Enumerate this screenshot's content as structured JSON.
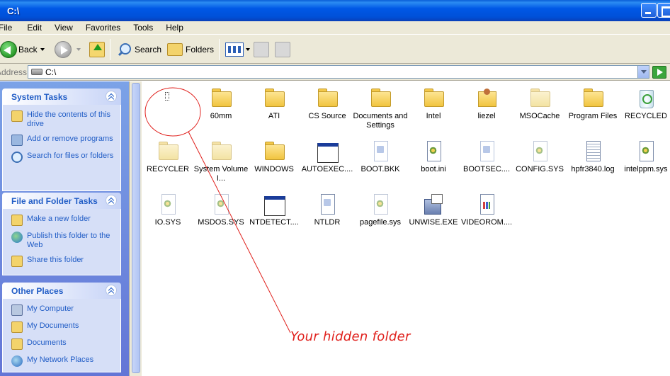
{
  "window": {
    "title": "C:\\"
  },
  "menu": [
    "File",
    "Edit",
    "View",
    "Favorites",
    "Tools",
    "Help"
  ],
  "toolbar": {
    "back_label": "Back",
    "search_label": "Search",
    "folders_label": "Folders"
  },
  "address": {
    "label": "Address",
    "value": "C:\\"
  },
  "panels": {
    "system_tasks": {
      "title": "System Tasks",
      "items": [
        "Hide the contents of this drive",
        "Add or remove programs",
        "Search for files or folders"
      ]
    },
    "file_folder_tasks": {
      "title": "File and Folder Tasks",
      "items": [
        "Make a new folder",
        "Publish this folder to the Web",
        "Share this folder"
      ]
    },
    "other_places": {
      "title": "Other Places",
      "items": [
        "My Computer",
        "My Documents",
        "Documents",
        "My Network Places"
      ]
    }
  },
  "files": [
    {
      "name": "",
      "icon": "hidden-folder-icon"
    },
    {
      "name": "60mm",
      "icon": "folder-icon"
    },
    {
      "name": "ATI",
      "icon": "folder-icon"
    },
    {
      "name": "CS Source",
      "icon": "folder-icon"
    },
    {
      "name": "Documents and Settings",
      "icon": "folder-icon"
    },
    {
      "name": "Intel",
      "icon": "folder-icon"
    },
    {
      "name": "liezel",
      "icon": "user-folder-icon"
    },
    {
      "name": "MSOCache",
      "icon": "folder-icon"
    },
    {
      "name": "Program Files",
      "icon": "folder-icon"
    },
    {
      "name": "RECYCLED",
      "icon": "recycle-bin-icon"
    },
    {
      "name": "RECYCLER",
      "icon": "folder-icon"
    },
    {
      "name": "System Volume I...",
      "icon": "folder-icon"
    },
    {
      "name": "WINDOWS",
      "icon": "folder-icon"
    },
    {
      "name": "AUTOEXEC....",
      "icon": "batch-file-icon"
    },
    {
      "name": "BOOT.BKK",
      "icon": "file-icon"
    },
    {
      "name": "boot.ini",
      "icon": "settings-file-icon"
    },
    {
      "name": "BOOTSEC....",
      "icon": "file-icon"
    },
    {
      "name": "CONFIG.SYS",
      "icon": "system-file-icon"
    },
    {
      "name": "hpfr3840.log",
      "icon": "log-file-icon"
    },
    {
      "name": "intelppm.sys",
      "icon": "system-file-icon"
    },
    {
      "name": "IO.SYS",
      "icon": "system-file-icon"
    },
    {
      "name": "MSDOS.SYS",
      "icon": "system-file-icon"
    },
    {
      "name": "NTDETECT....",
      "icon": "application-icon"
    },
    {
      "name": "NTLDR",
      "icon": "file-icon"
    },
    {
      "name": "pagefile.sys",
      "icon": "system-file-icon"
    },
    {
      "name": "UNWISE.EXE",
      "icon": "setup-icon"
    },
    {
      "name": "VIDEOROM....",
      "icon": "chart-file-icon"
    }
  ],
  "annotation": {
    "text": "Your hidden folder",
    "color": "#e0201c"
  }
}
